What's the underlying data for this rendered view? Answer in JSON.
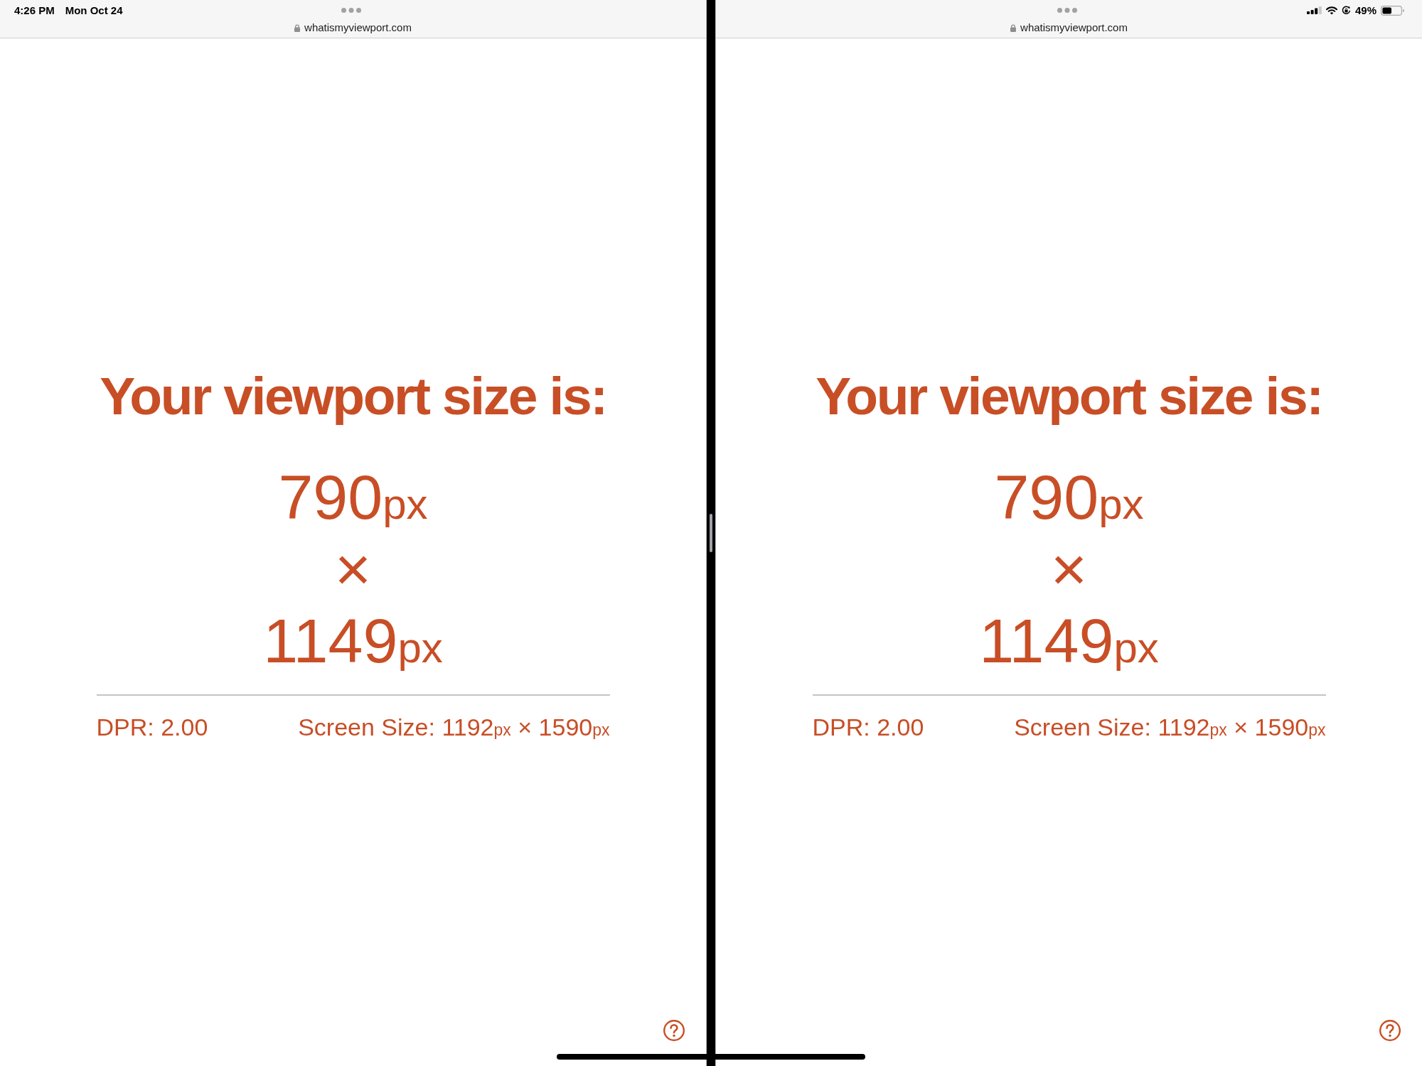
{
  "status_bar": {
    "time": "4:26 PM",
    "date": "Mon Oct 24",
    "battery": "49%"
  },
  "panes": [
    {
      "url": "whatismyviewport.com",
      "heading": "Your viewport size is:",
      "viewport_width": {
        "value": "790",
        "unit": "px"
      },
      "times_sign": "×",
      "viewport_height": {
        "value": "1149",
        "unit": "px"
      },
      "dpr": "DPR: 2.00",
      "screen_size": {
        "label": "Screen Size:",
        "parts": [
          {
            "kind": "number",
            "text": "1192"
          },
          {
            "kind": "unit",
            "text": "px"
          },
          {
            "kind": "sign",
            "text": "×"
          },
          {
            "kind": "number",
            "text": "1590"
          },
          {
            "kind": "unit",
            "text": "px"
          }
        ]
      }
    },
    {
      "url": "whatismyviewport.com",
      "heading": "Your viewport size is:",
      "viewport_width": {
        "value": "790",
        "unit": "px"
      },
      "times_sign": "×",
      "viewport_height": {
        "value": "1149",
        "unit": "px"
      },
      "dpr": "DPR: 2.00",
      "screen_size": {
        "label": "Screen Size:",
        "parts": [
          {
            "kind": "number",
            "text": "1192"
          },
          {
            "kind": "unit",
            "text": "px"
          },
          {
            "kind": "sign",
            "text": "×"
          },
          {
            "kind": "number",
            "text": "1590"
          },
          {
            "kind": "unit",
            "text": "px"
          }
        ]
      }
    }
  ]
}
